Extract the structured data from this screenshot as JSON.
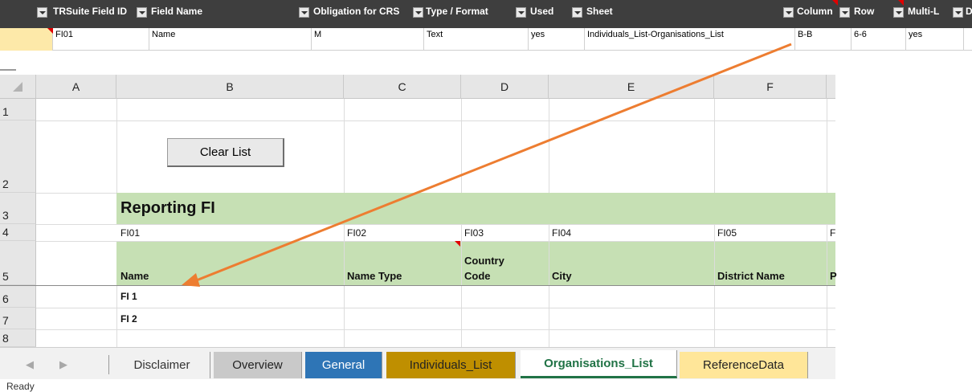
{
  "filter_table": {
    "headers": [
      "TRSuite Field ID",
      "Field Name",
      "Obligation for CRS",
      "Type / Format",
      "Used",
      "Sheet",
      "Column",
      "Row",
      "Multi-L",
      "D"
    ],
    "row": [
      "FI01",
      "Name",
      "M",
      "Text",
      "yes",
      "Individuals_List-Organisations_List",
      "B-B",
      "6-6",
      "yes"
    ]
  },
  "sheet": {
    "columns": [
      "A",
      "B",
      "C",
      "D",
      "E",
      "F"
    ],
    "rows": [
      "1",
      "2",
      "3",
      "4",
      "5",
      "6",
      "7",
      "8"
    ],
    "clear_button": "Clear List",
    "section_title": "Reporting FI",
    "field_ids": [
      "FI01",
      "FI02",
      "FI03",
      "FI04",
      "FI05",
      "F"
    ],
    "field_names": {
      "name": "Name",
      "name_type": "Name Type",
      "country_code_line1": "Country",
      "country_code_line2": "Code",
      "city": "City",
      "district": "District Name",
      "partial": "P"
    },
    "data_rows": [
      "FI 1",
      "FI 2"
    ]
  },
  "tabs": [
    {
      "label": "Disclaimer"
    },
    {
      "label": "Overview"
    },
    {
      "label": "General"
    },
    {
      "label": "Individuals_List"
    },
    {
      "label": "Organisations_List"
    },
    {
      "label": "ReferenceData"
    }
  ],
  "status": {
    "text": "Ready"
  },
  "colors": {
    "accent_arrow": "#ed7d31",
    "green_fill": "#c6e0b4",
    "active_tab_text": "#217346"
  }
}
